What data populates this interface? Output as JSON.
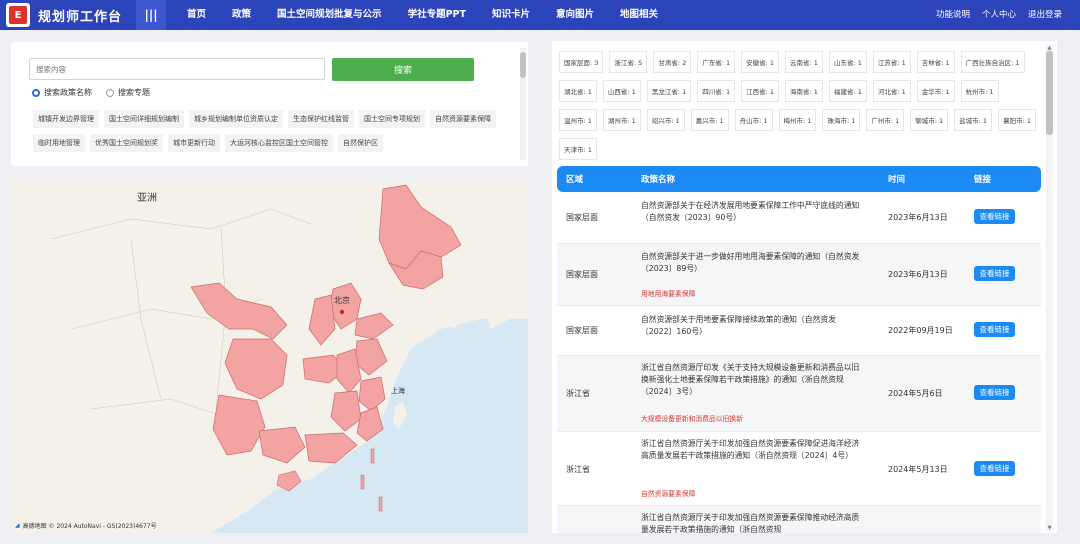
{
  "app": {
    "logo_char": "E",
    "title": "规划师工作台",
    "menu_icon": "menu-icon"
  },
  "nav": [
    "首页",
    "政策",
    "国土空间规划批复与公示",
    "学社专题PPT",
    "知识卡片",
    "意向图片",
    "地图相关"
  ],
  "nav_right": [
    "功能说明",
    "个人中心",
    "退出登录"
  ],
  "search": {
    "placeholder": "搜索内容",
    "button": "搜索",
    "radio_1": "搜索政策名称",
    "radio_2": "搜索专题",
    "tags": [
      "城镇开发边界管理",
      "国土空间详细规划编制",
      "城乡规划编制单位资质认定",
      "生态保护红线监管",
      "国土空间专项规划",
      "自然资源要素保障",
      "临时用地管理",
      "优秀国土空间规划奖",
      "城市更新行动",
      "大运河核心监控区国土空间管控",
      "自然保护区"
    ]
  },
  "map": {
    "label_asia": "亚洲",
    "label_beijing": "北京",
    "label_shanghai": "上海",
    "footer": "高德地图 © 2024 AutoNavi - GS(2023)4677号",
    "colors": {
      "water": "#d5e8f3",
      "land": "#f3f1ea",
      "highlight": "#f4a3a3",
      "border": "#cc6b6b"
    }
  },
  "regions": [
    "国家层面: 3",
    "浙江省: 5",
    "甘肃省: 2",
    "广东省: 1",
    "安徽省: 1",
    "云南省: 1",
    "山东省: 1",
    "江苏省: 1",
    "吉林省: 1",
    "广西壮族自治区: 1",
    "湖北省: 1",
    "山西省: 1",
    "黑龙江省: 1",
    "四川省: 1",
    "江西省: 1",
    "海南省: 1",
    "福建省: 1",
    "河北省: 1",
    "金华市: 1",
    "杭州市: 1",
    "温州市: 1",
    "湖州市: 1",
    "绍兴市: 1",
    "嘉兴市: 1",
    "舟山市: 1",
    "梅州市: 1",
    "珠海市: 1",
    "广州市: 1",
    "聊城市: 1",
    "盐城市: 1",
    "襄阳市: 1",
    "天津市: 1"
  ],
  "table": {
    "headers": {
      "region": "区域",
      "title": "政策名称",
      "date": "时间",
      "link": "链接"
    },
    "link_label": "查看链接",
    "rows": [
      {
        "region": "国家层面",
        "title": "自然资源部关于在经济发展用地要素保障工作中严守底线的通知（自然资发〔2023〕90号）",
        "tag": "",
        "date": "2023年6月13日"
      },
      {
        "region": "国家层面",
        "title": "自然资源部关于进一步做好用地用海要素保障的通知（自然资发〔2023〕89号）",
        "tag": "用地用海要素保障",
        "date": "2023年6月13日"
      },
      {
        "region": "国家层面",
        "title": "自然资源部关于用地要素保障接续政策的通知（自然资发〔2022〕160号）",
        "tag": "",
        "date": "2022年09月19日"
      },
      {
        "region": "浙江省",
        "title": "浙江省自然资源厅印发《关于支持大规模设备更新和消费品以旧换新强化土地要素保障若干政策措施》的通知（浙自然资规〔2024〕3号）",
        "tag": "大规模设备更新和消费品以旧换新",
        "date": "2024年5月6日"
      },
      {
        "region": "浙江省",
        "title": "浙江省自然资源厅关于印发加强自然资源要素保障促进海洋经济高质量发展若干政策措施的通知（浙自然资规〔2024〕4号）",
        "tag": "自然资源要素保障",
        "date": "2024年5月13日"
      },
      {
        "region": "",
        "title": "浙江省自然资源厅关于印发加强自然资源要素保障推动经济高质量发展若干政策措施的通知（浙自然资规",
        "tag": "",
        "date": ""
      }
    ]
  }
}
